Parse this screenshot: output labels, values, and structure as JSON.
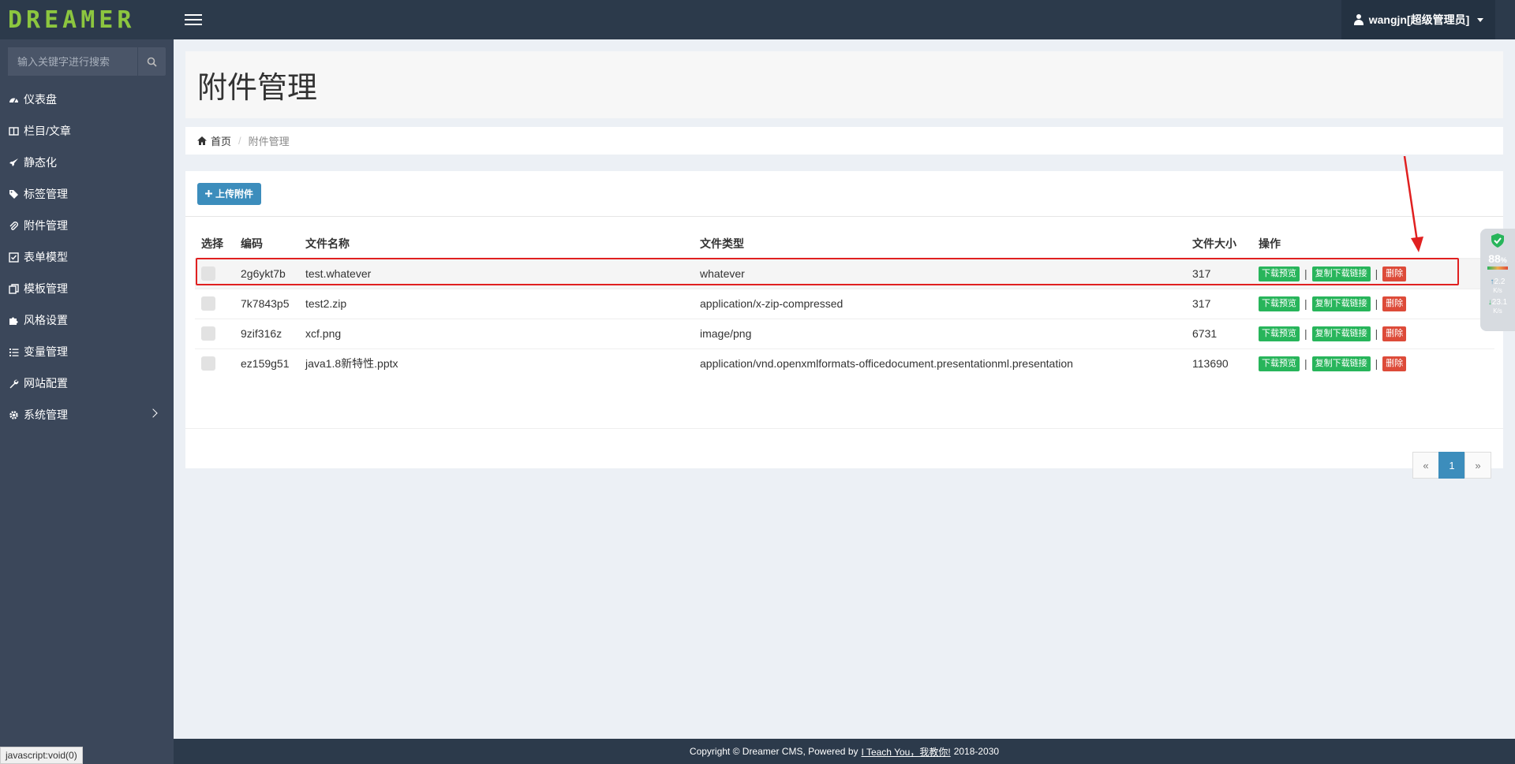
{
  "app": {
    "logo": "DREAMER",
    "user": "wangjn[超级管理员]"
  },
  "search": {
    "placeholder": "输入关键字进行搜索"
  },
  "sidebar": {
    "items": [
      {
        "label": "仪表盘",
        "icon": "dashboard-icon"
      },
      {
        "label": "栏目/文章",
        "icon": "columns-icon"
      },
      {
        "label": "静态化",
        "icon": "rocket-icon"
      },
      {
        "label": "标签管理",
        "icon": "tags-icon"
      },
      {
        "label": "附件管理",
        "icon": "paperclip-icon"
      },
      {
        "label": "表单模型",
        "icon": "checkbox-icon"
      },
      {
        "label": "模板管理",
        "icon": "copy-icon"
      },
      {
        "label": "风格设置",
        "icon": "puzzle-icon"
      },
      {
        "label": "变量管理",
        "icon": "list-icon"
      },
      {
        "label": "网站配置",
        "icon": "wrench-icon"
      },
      {
        "label": "系统管理",
        "icon": "gear-icon"
      }
    ]
  },
  "page": {
    "title": "附件管理",
    "breadcrumb_home": "首页",
    "breadcrumb_current": "附件管理",
    "upload_label": "上传附件"
  },
  "table": {
    "headers": [
      "选择",
      "编码",
      "文件名称",
      "文件类型",
      "文件大小",
      "操作"
    ],
    "rows": [
      {
        "code": "2g6ykt7b",
        "name": "test.whatever",
        "type": "whatever",
        "size": "317"
      },
      {
        "code": "7k7843p5",
        "name": "test2.zip",
        "type": "application/x-zip-compressed",
        "size": "317"
      },
      {
        "code": "9zif316z",
        "name": "xcf.png",
        "type": "image/png",
        "size": "6731"
      },
      {
        "code": "ez159g51",
        "name": "java1.8新特性.pptx",
        "type": "application/vnd.openxmlformats-officedocument.presentationml.presentation",
        "size": "113690"
      }
    ],
    "actions": {
      "preview": "下载预览",
      "copy": "复制下载链接",
      "delete": "删除",
      "separator": "|"
    }
  },
  "pagination": {
    "prev": "«",
    "current": "1",
    "next": "»"
  },
  "footer": {
    "prefix": "Copyright © Dreamer CMS, Powered by",
    "link": "I Teach You，我教你!",
    "years": "2018-2030"
  },
  "statusbar": "javascript:void(0)",
  "widget": {
    "percent": "88",
    "percent_unit": "%",
    "up": "2.2",
    "down": "23.1",
    "unit": "K/s"
  },
  "colors": {
    "topbar": "#2c3a4b",
    "sidebar": "#3b475a",
    "primary": "#3c8dbc",
    "green": "#28b55b",
    "red": "#dd4b39",
    "logo": "#8cc63f"
  }
}
